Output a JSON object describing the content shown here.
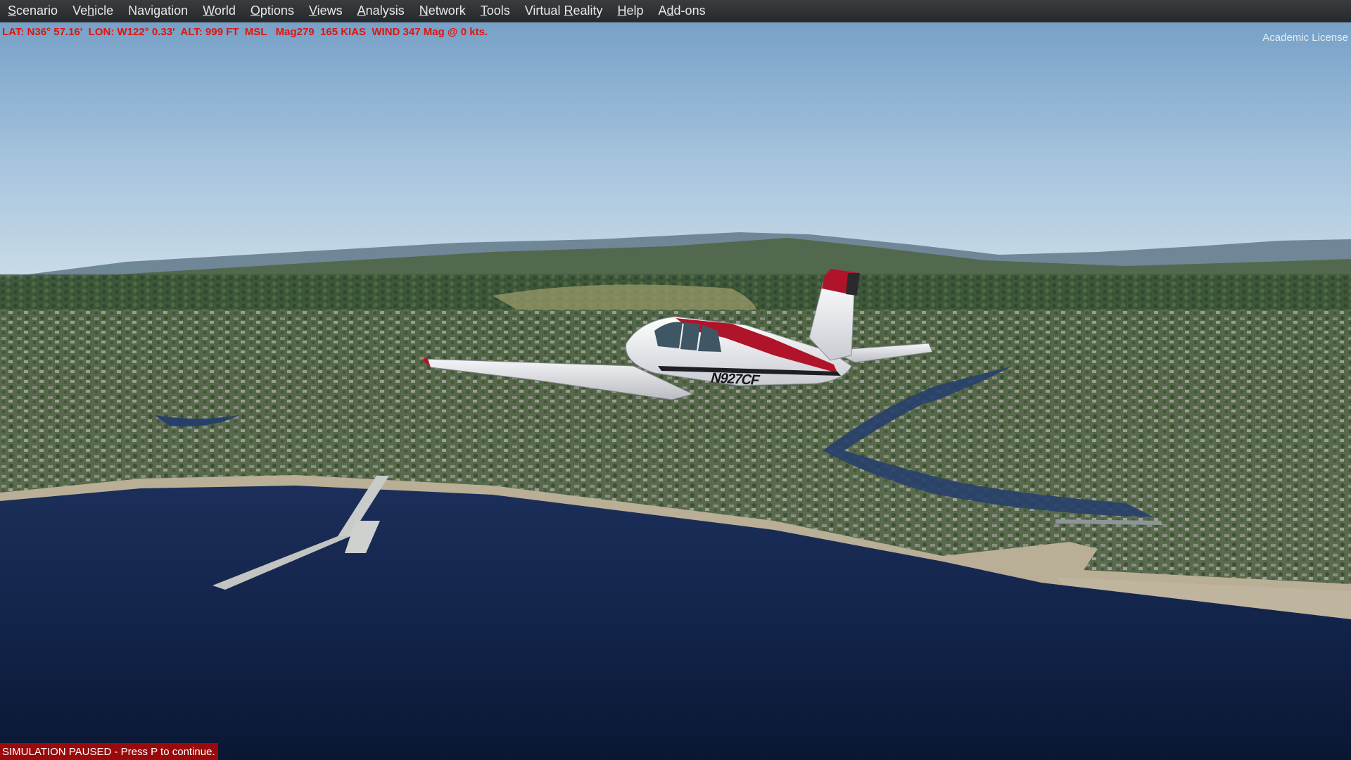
{
  "menu": [
    {
      "pre": "",
      "key": "S",
      "post": "cenario",
      "name": "menu-scenario"
    },
    {
      "pre": "Ve",
      "key": "h",
      "post": "icle",
      "name": "menu-vehicle"
    },
    {
      "pre": "Navi",
      "key": "g",
      "post": "ation",
      "name": "menu-navigation"
    },
    {
      "pre": "",
      "key": "W",
      "post": "orld",
      "name": "menu-world"
    },
    {
      "pre": "",
      "key": "O",
      "post": "ptions",
      "name": "menu-options"
    },
    {
      "pre": "",
      "key": "V",
      "post": "iews",
      "name": "menu-views"
    },
    {
      "pre": "",
      "key": "A",
      "post": "nalysis",
      "name": "menu-analysis"
    },
    {
      "pre": "",
      "key": "N",
      "post": "etwork",
      "name": "menu-network"
    },
    {
      "pre": "",
      "key": "T",
      "post": "ools",
      "name": "menu-tools"
    },
    {
      "pre": "Virtual ",
      "key": "R",
      "post": "eality",
      "name": "menu-virtual-reality"
    },
    {
      "pre": "",
      "key": "H",
      "post": "elp",
      "name": "menu-help"
    },
    {
      "pre": "A",
      "key": "d",
      "post": "d-ons",
      "name": "menu-addons"
    }
  ],
  "hud": {
    "readout": "LAT: N36° 57.16'  LON: W122° 0.33'  ALT: 999 FT  MSL   Mag279  165 KIAS  WIND 347 Mag @ 0 kts."
  },
  "license": "Academic License",
  "status": {
    "paused": "SIMULATION PAUSED - Press P to continue."
  },
  "aircraft": {
    "registration": "N927CF"
  },
  "colors": {
    "hud_text": "#e0140c",
    "paused_bg": "#9a0a0a",
    "menubar_bg": "#2e3134",
    "aircraft_stripe": "#b0142a"
  }
}
